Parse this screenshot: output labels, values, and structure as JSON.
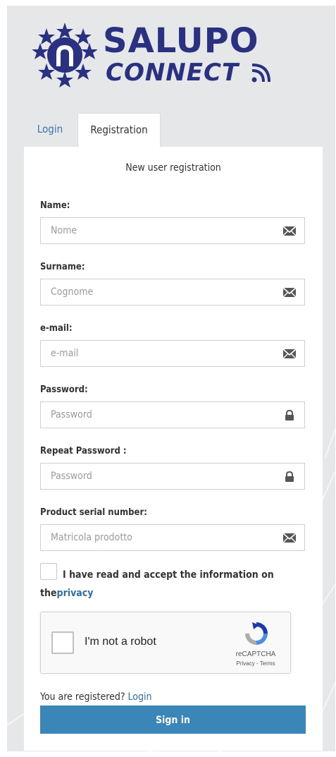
{
  "logo": {
    "title": "SALUPO",
    "subtitle": "CONNECT",
    "colors": {
      "primary": "#2a3180"
    }
  },
  "tabs": [
    {
      "label": "Login",
      "active": false
    },
    {
      "label": "Registration",
      "active": true
    }
  ],
  "form": {
    "title": "New user registration",
    "fields": [
      {
        "label": "Name:",
        "placeholder": "Nome",
        "icon": "envelope-icon"
      },
      {
        "label": "Surname:",
        "placeholder": "Cognome",
        "icon": "envelope-icon"
      },
      {
        "label": "e-mail:",
        "placeholder": "e-mail",
        "icon": "envelope-icon"
      },
      {
        "label": "Password:",
        "placeholder": "Password",
        "icon": "lock-icon"
      },
      {
        "label": "Repeat Password :",
        "placeholder": "Password",
        "icon": "lock-icon"
      },
      {
        "label": "Product serial number:",
        "placeholder": "Matricola prodotto",
        "icon": "envelope-icon"
      }
    ],
    "consent": {
      "text": "I have read and accept the information on the",
      "link": "privacy"
    },
    "captcha": {
      "label": "I'm not a robot",
      "brand": "reCAPTCHA",
      "links": "Privacy - Terms"
    },
    "registered_text": "You are registered?",
    "registered_link": "Login",
    "submit_label": "Sign in"
  },
  "colors": {
    "accent": "#3a86b8",
    "link": "#2f6ea7",
    "background": "#e6e7e9"
  }
}
